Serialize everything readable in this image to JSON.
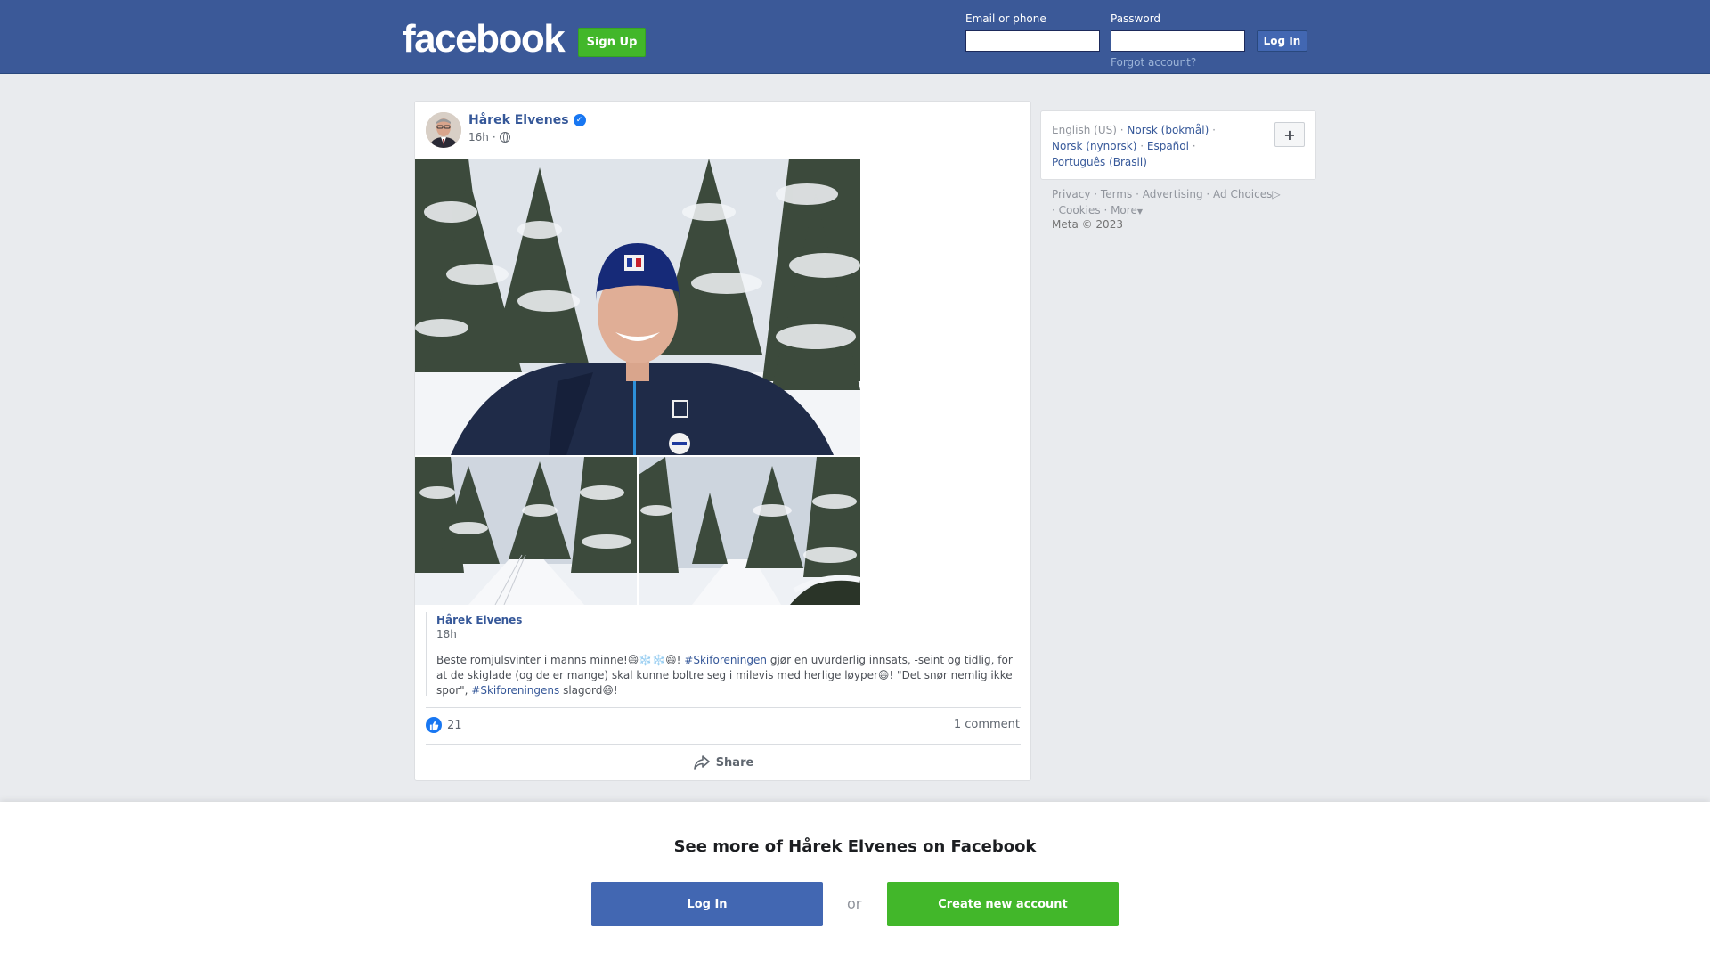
{
  "header": {
    "logo": "facebook",
    "signup_label": "Sign Up",
    "email_label": "Email or phone",
    "password_label": "Password",
    "login_label": "Log In",
    "forgot_label": "Forgot account?"
  },
  "post": {
    "author": "Hårek Elvenes",
    "time": "16h",
    "shared": {
      "author": "Hårek Elvenes",
      "time": "18h",
      "text_1": "Beste romjulsvinter i manns minne!😄❄️❄️😄! ",
      "hashtag_1": "#Skiforeningen",
      "text_2": " gjør en uvurderlig innsats, -seint og tidlig, for at de skiglade (og de er mange) skal kunne boltre seg i milevis med herlige løyper😄! \"Det snør nemlig ikke spor\", ",
      "hashtag_2": "#Skiforeningens",
      "text_3": " slagord😄!"
    },
    "like_count": "21",
    "comment_count": "1 comment",
    "share_label": "Share"
  },
  "sidebar": {
    "lang_current": "English (US)",
    "languages": [
      "Norsk (bokmål)",
      "Norsk (nynorsk)",
      "Español",
      "Português (Brasil)"
    ],
    "add_label": "+",
    "footer_links": [
      "Privacy",
      "Terms",
      "Advertising",
      "Ad Choices",
      "Cookies",
      "More"
    ],
    "copyright": "Meta © 2023"
  },
  "bottom": {
    "title": "See more of Hårek Elvenes on Facebook",
    "login_label": "Log In",
    "or_label": "or",
    "create_label": "Create new account"
  },
  "colors": {
    "header_bg": "#3b5998",
    "link": "#365899",
    "green": "#42b72a",
    "blue_button": "#4267b2"
  },
  "icons": [
    "verified-badge-icon",
    "globe-icon",
    "like-icon",
    "share-icon",
    "ad-choices-icon",
    "dropdown-caret-icon"
  ]
}
